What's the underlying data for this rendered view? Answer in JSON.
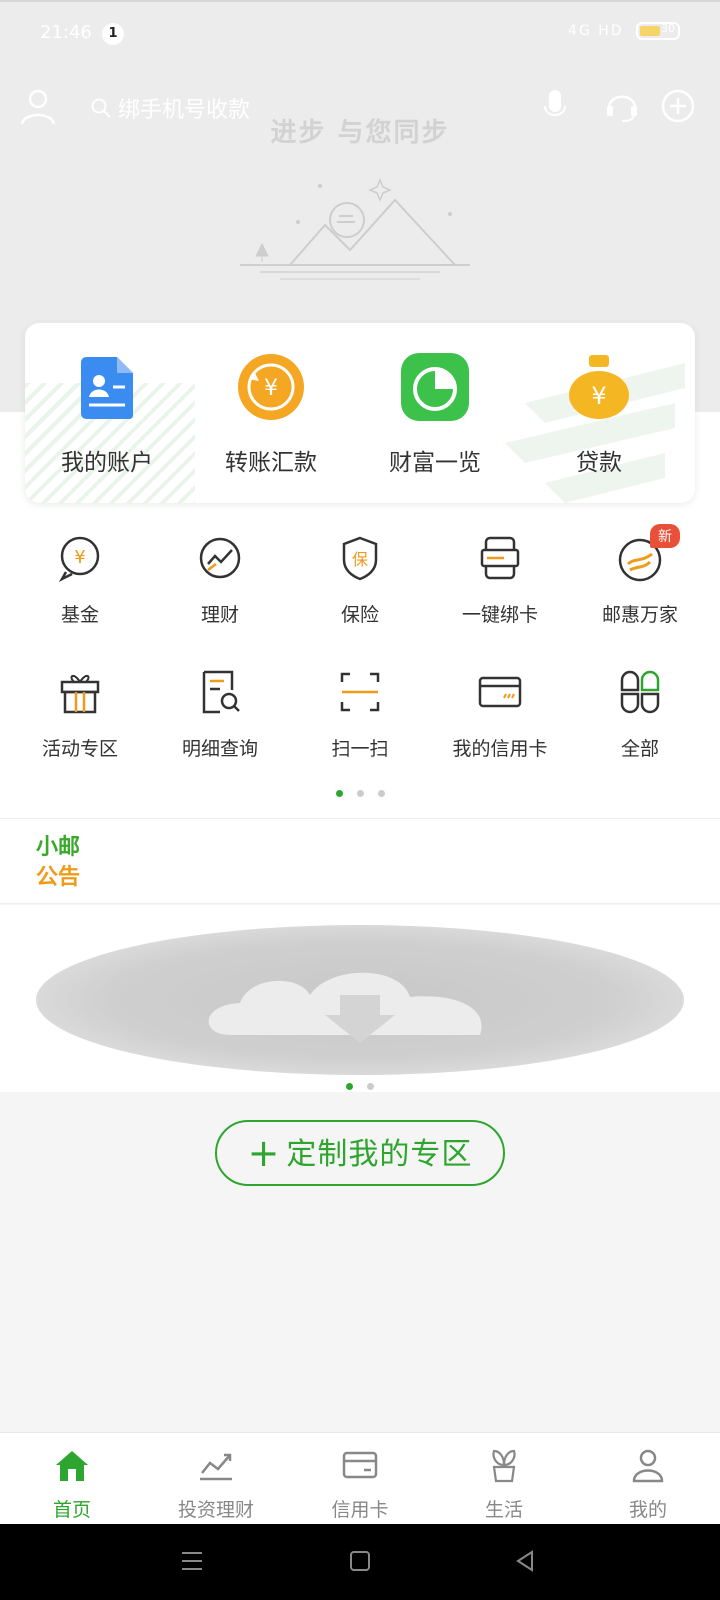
{
  "status_bar": {
    "time": "21:46",
    "notification_count": "1",
    "signal_text": "4G HD",
    "battery": "30"
  },
  "header": {
    "search_placeholder": "绑手机号收款",
    "slogan": "进步  与您同步"
  },
  "quick_actions": [
    {
      "label": "我的账户",
      "icon": "account-card-icon",
      "color": "#3b8cf0"
    },
    {
      "label": "转账汇款",
      "icon": "transfer-coin-icon",
      "color": "#f5a623"
    },
    {
      "label": "财富一览",
      "icon": "wealth-pie-icon",
      "color": "#3cc24a"
    },
    {
      "label": "贷款",
      "icon": "loan-bag-icon",
      "color": "#f5b623"
    }
  ],
  "grid_row1": [
    {
      "label": "基金",
      "icon": "fund-icon"
    },
    {
      "label": "理财",
      "icon": "finance-chart-icon"
    },
    {
      "label": "保险",
      "icon": "insurance-shield-icon"
    },
    {
      "label": "一键绑卡",
      "icon": "bind-card-icon"
    },
    {
      "label": "邮惠万家",
      "icon": "youhui-icon",
      "badge": "新"
    }
  ],
  "grid_row2": [
    {
      "label": "活动专区",
      "icon": "gift-icon"
    },
    {
      "label": "明细查询",
      "icon": "detail-search-icon"
    },
    {
      "label": "扫一扫",
      "icon": "scan-icon"
    },
    {
      "label": "我的信用卡",
      "icon": "credit-card-icon"
    },
    {
      "label": "全部",
      "icon": "all-apps-icon"
    }
  ],
  "notice": {
    "tag_line1": "小邮",
    "tag_line2": "公告"
  },
  "custom_button": {
    "plus": "+",
    "label": "定制我的专区"
  },
  "tabs": [
    {
      "label": "首页",
      "icon": "home-icon",
      "active": true
    },
    {
      "label": "投资理财",
      "icon": "invest-icon",
      "active": false
    },
    {
      "label": "信用卡",
      "icon": "card-icon",
      "active": false
    },
    {
      "label": "生活",
      "icon": "plant-icon",
      "active": false
    },
    {
      "label": "我的",
      "icon": "profile-icon",
      "active": false
    }
  ],
  "colors": {
    "accent": "#2ea52e",
    "orange": "#f09a1a"
  }
}
